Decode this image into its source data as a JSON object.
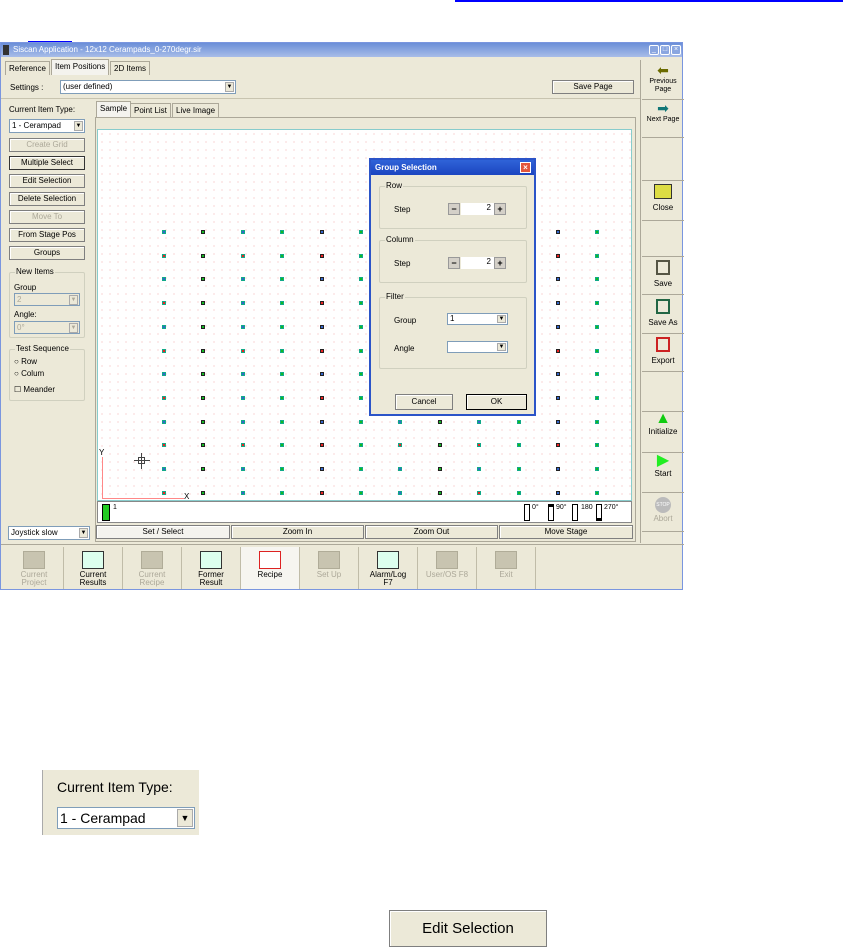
{
  "window": {
    "title": "Siscan Application - 12x12 Cerampads_0-270degr.sir"
  },
  "top_tabs": [
    "Reference",
    "Item Positions",
    "2D Items"
  ],
  "settings": {
    "label": "Settings :",
    "value": "(user defined)",
    "save_page": "Save Page"
  },
  "left": {
    "item_type_label": "Current Item Type:",
    "item_type_value": "1 - Cerampad",
    "buttons": [
      "Create Grid",
      "Multiple Select",
      "Edit Selection",
      "Delete Selection",
      "Move To",
      "From Stage Pos",
      "Groups"
    ],
    "new_items": {
      "title": "New Items",
      "group_label": "Group",
      "group_value": "2",
      "angle_label": "Angle:",
      "angle_value": "0°"
    },
    "test_sequence": {
      "title": "Test Sequence",
      "row": "Row",
      "column": "Colum",
      "meander": "Meander"
    },
    "joystick": "Joystick slow"
  },
  "view_tabs": [
    "Sample",
    "Point List",
    "Live Image"
  ],
  "canvas": {
    "axis_x": "X",
    "axis_y": "Y",
    "rows": 12,
    "cols": 12
  },
  "status": {
    "group_number": "1",
    "angles": [
      "0°",
      "90°",
      "180",
      "270°"
    ]
  },
  "canvas_buttons": [
    "Set / Select",
    "Zoom In",
    "Zoom Out",
    "Move Stage"
  ],
  "dialog": {
    "title": "Group Selection",
    "row_title": "Row",
    "row_step_label": "Step",
    "row_step": "2",
    "col_title": "Column",
    "col_step_label": "Step",
    "col_step": "2",
    "filter_title": "Filter",
    "filter_group_label": "Group",
    "filter_group": "1",
    "filter_angle_label": "Angle",
    "filter_angle": "",
    "cancel": "Cancel",
    "ok": "OK"
  },
  "right_toolbar": [
    {
      "label": "Previous Page",
      "icon": "arrow-left-icon"
    },
    {
      "label": "Next Page",
      "icon": "arrow-right-icon"
    },
    {
      "label": "Close",
      "icon": "folder-icon"
    },
    {
      "label": "Save",
      "icon": "floppy-icon"
    },
    {
      "label": "Save As",
      "icon": "floppy-icon"
    },
    {
      "label": "Export",
      "icon": "floppy-icon"
    },
    {
      "label": "Initialize",
      "icon": "triangle-icon"
    },
    {
      "label": "Start",
      "icon": "play-icon"
    },
    {
      "label": "Abort",
      "icon": "stop-icon"
    }
  ],
  "taskbar": [
    {
      "label": "Current Project",
      "enabled": false
    },
    {
      "label": "Current Results",
      "enabled": true
    },
    {
      "label": "Current Recipe",
      "enabled": false
    },
    {
      "label": "Former Result",
      "enabled": true
    },
    {
      "label": "Recipe",
      "enabled": true
    },
    {
      "label": "Set Up",
      "enabled": false
    },
    {
      "label": "Alarm/Log F7",
      "enabled": true
    },
    {
      "label": "User/OS F8",
      "enabled": false
    },
    {
      "label": "Exit",
      "enabled": false
    }
  ],
  "zoomed": {
    "item_type_label": "Current Item Type:",
    "item_type_value": "1 - Cerampad",
    "edit_selection": "Edit Selection"
  }
}
